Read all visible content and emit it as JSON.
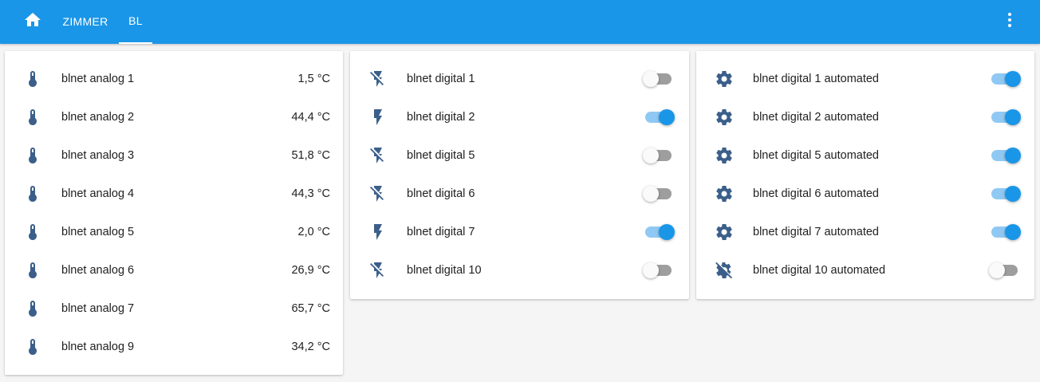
{
  "app": {
    "brand_color": "#1a96e8",
    "icon_color": "#3b5f8a",
    "home_icon": "home-icon",
    "menu_icon": "more-vertical-icon"
  },
  "tabs": [
    {
      "label": "ZIMMER",
      "active": false
    },
    {
      "label": "BL",
      "active": true
    }
  ],
  "analog_card": {
    "items": [
      {
        "name": "blnet analog 1",
        "value": "1,5 °C",
        "icon": "thermometer-icon"
      },
      {
        "name": "blnet analog 2",
        "value": "44,4 °C",
        "icon": "thermometer-icon"
      },
      {
        "name": "blnet analog 3",
        "value": "51,8 °C",
        "icon": "thermometer-icon"
      },
      {
        "name": "blnet analog 4",
        "value": "44,3 °C",
        "icon": "thermometer-icon"
      },
      {
        "name": "blnet analog 5",
        "value": "2,0 °C",
        "icon": "thermometer-icon"
      },
      {
        "name": "blnet analog 6",
        "value": "26,9 °C",
        "icon": "thermometer-icon"
      },
      {
        "name": "blnet analog 7",
        "value": "65,7 °C",
        "icon": "thermometer-icon"
      },
      {
        "name": "blnet analog 9",
        "value": "34,2 °C",
        "icon": "thermometer-icon"
      }
    ]
  },
  "digital_card": {
    "items": [
      {
        "name": "blnet digital 1",
        "on": false,
        "icon": "flash-off-icon"
      },
      {
        "name": "blnet digital 2",
        "on": true,
        "icon": "flash-icon"
      },
      {
        "name": "blnet digital 5",
        "on": false,
        "icon": "flash-off-icon"
      },
      {
        "name": "blnet digital 6",
        "on": false,
        "icon": "flash-off-icon"
      },
      {
        "name": "blnet digital 7",
        "on": true,
        "icon": "flash-icon"
      },
      {
        "name": "blnet digital 10",
        "on": false,
        "icon": "flash-off-icon"
      }
    ]
  },
  "automated_card": {
    "items": [
      {
        "name": "blnet digital 1 automated",
        "on": true,
        "icon": "gear-icon"
      },
      {
        "name": "blnet digital 2 automated",
        "on": true,
        "icon": "gear-icon"
      },
      {
        "name": "blnet digital 5 automated",
        "on": true,
        "icon": "gear-icon"
      },
      {
        "name": "blnet digital 6 automated",
        "on": true,
        "icon": "gear-icon"
      },
      {
        "name": "blnet digital 7 automated",
        "on": true,
        "icon": "gear-icon"
      },
      {
        "name": "blnet digital 10 automated",
        "on": false,
        "icon": "gear-off-icon"
      }
    ]
  }
}
